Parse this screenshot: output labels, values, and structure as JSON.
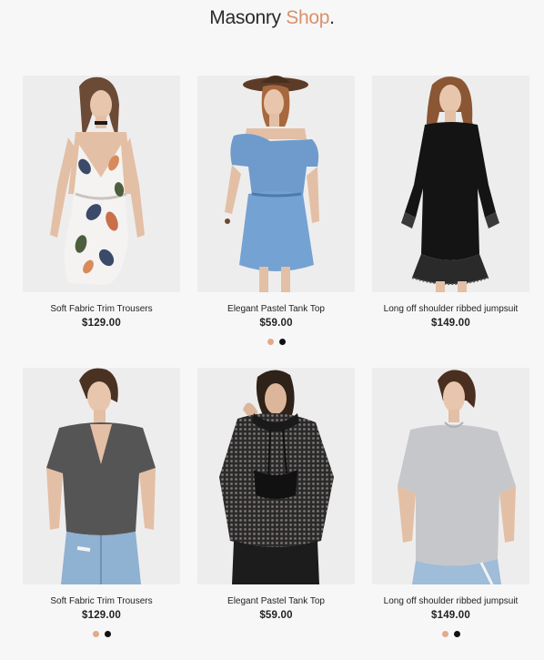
{
  "logo": {
    "name": "Masonry",
    "accent": "Shop",
    "dot": "."
  },
  "colors": {
    "accent": "#d8926a",
    "swatch_peach": "#e3aa8a",
    "swatch_black": "#111111"
  },
  "products": [
    {
      "name": "Soft Fabric Trim Trousers",
      "price": "$129.00",
      "swatches": []
    },
    {
      "name": "Elegant Pastel Tank Top",
      "price": "$59.00",
      "swatches": [
        "#e3aa8a",
        "#111111"
      ]
    },
    {
      "name": "Long off shoulder ribbed jumpsuit",
      "price": "$149.00",
      "swatches": []
    },
    {
      "name": "Soft Fabric Trim Trousers",
      "price": "$129.00",
      "swatches": [
        "#e3aa8a",
        "#111111"
      ]
    },
    {
      "name": "Elegant Pastel Tank Top",
      "price": "$59.00",
      "swatches": []
    },
    {
      "name": "Long off shoulder ribbed jumpsuit",
      "price": "$149.00",
      "swatches": [
        "#e3aa8a",
        "#111111"
      ]
    }
  ]
}
